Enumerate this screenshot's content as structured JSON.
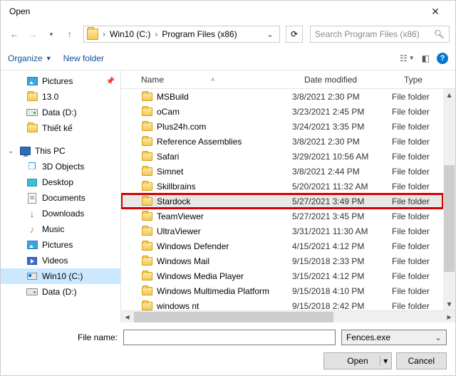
{
  "window": {
    "title": "Open",
    "close": "✕"
  },
  "nav": {
    "breadcrumb": [
      "Win10 (C:)",
      "Program Files (x86)"
    ],
    "search_placeholder": "Search Program Files (x86)"
  },
  "toolbar": {
    "organize": "Organize",
    "new_folder": "New folder"
  },
  "sidebar": {
    "quick": [
      {
        "label": "Pictures",
        "icon": "pictures",
        "pinned": true
      },
      {
        "label": "13.0",
        "icon": "folder"
      },
      {
        "label": "Data (D:)",
        "icon": "drive"
      },
      {
        "label": "Thiết kế",
        "icon": "folder"
      }
    ],
    "thispc_label": "This PC",
    "thispc": [
      {
        "label": "3D Objects",
        "icon": "3d"
      },
      {
        "label": "Desktop",
        "icon": "desk"
      },
      {
        "label": "Documents",
        "icon": "doc"
      },
      {
        "label": "Downloads",
        "icon": "dl"
      },
      {
        "label": "Music",
        "icon": "music"
      },
      {
        "label": "Pictures",
        "icon": "pictures"
      },
      {
        "label": "Videos",
        "icon": "video"
      },
      {
        "label": "Win10 (C:)",
        "icon": "win",
        "selected": true
      },
      {
        "label": "Data (D:)",
        "icon": "drive"
      }
    ]
  },
  "columns": {
    "name": "Name",
    "date": "Date modified",
    "type": "Type"
  },
  "files": [
    {
      "name": "MSBuild",
      "date": "3/8/2021 2:30 PM",
      "type": "File folder"
    },
    {
      "name": "oCam",
      "date": "3/23/2021 2:45 PM",
      "type": "File folder"
    },
    {
      "name": "Plus24h.com",
      "date": "3/24/2021 3:35 PM",
      "type": "File folder"
    },
    {
      "name": "Reference Assemblies",
      "date": "3/8/2021 2:30 PM",
      "type": "File folder"
    },
    {
      "name": "Safari",
      "date": "3/29/2021 10:56 AM",
      "type": "File folder"
    },
    {
      "name": "Simnet",
      "date": "3/8/2021 2:44 PM",
      "type": "File folder"
    },
    {
      "name": "Skillbrains",
      "date": "5/20/2021 11:32 AM",
      "type": "File folder"
    },
    {
      "name": "Stardock",
      "date": "5/27/2021 3:49 PM",
      "type": "File folder",
      "highlighted": true
    },
    {
      "name": "TeamViewer",
      "date": "5/27/2021 3:45 PM",
      "type": "File folder"
    },
    {
      "name": "UltraViewer",
      "date": "3/31/2021 11:30 AM",
      "type": "File folder"
    },
    {
      "name": "Windows Defender",
      "date": "4/15/2021 4:12 PM",
      "type": "File folder"
    },
    {
      "name": "Windows Mail",
      "date": "9/15/2018 2:33 PM",
      "type": "File folder"
    },
    {
      "name": "Windows Media Player",
      "date": "3/15/2021 4:12 PM",
      "type": "File folder"
    },
    {
      "name": "Windows Multimedia Platform",
      "date": "9/15/2018 4:10 PM",
      "type": "File folder"
    },
    {
      "name": "windows nt",
      "date": "9/15/2018 2:42 PM",
      "type": "File folder"
    }
  ],
  "bottom": {
    "filename_label": "File name:",
    "filename_value": "",
    "filter": "Fences.exe",
    "open": "Open",
    "cancel": "Cancel"
  }
}
